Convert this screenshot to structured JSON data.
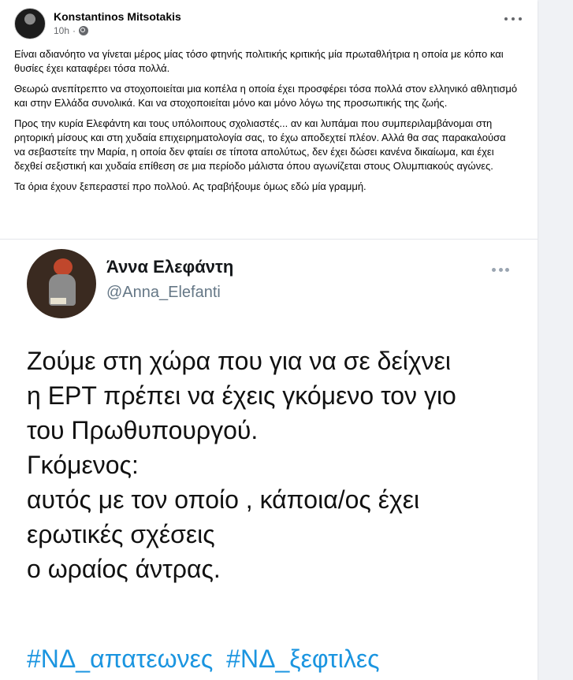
{
  "post": {
    "author": "Konstantinos Mitsotakis",
    "time": "10h",
    "separator": "·",
    "audience_icon": "globe-icon",
    "more_icon": "more-options-icon",
    "paragraphs": [
      "Είναι αδιανόητο να γίνεται μέρος μίας τόσο φτηνής πολιτικής κριτικής μία πρωταθλήτρια η οποία με κόπο και θυσίες έχει καταφέρει τόσα πολλά.",
      "Θεωρώ ανεπίτρεπτο να στοχοποιείται μια κοπέλα η οποία έχει προσφέρει τόσα πολλά στον ελληνικό αθλητισμό και στην Ελλάδα συνολικά. Και να στοχοποιείται μόνο και μόνο λόγω της προσωπικής της ζωής.",
      "Προς την κυρία Ελεφάντη και τους υπόλοιπους σχολιαστές... αν και λυπάμαι που συμπεριλαμβάνομαι στη ρητορική μίσους και στη χυδαία επιχειρηματολογία σας, το έχω αποδεχτεί πλέον. Αλλά θα σας παρακαλούσα να σεβαστείτε την Μαρία, η οποία δεν φταίει σε τίποτα απολύτως, δεν έχει δώσει κανένα δικαίωμα, και έχει δεχθεί σεξιστική και χυδαία επίθεση σε μια περίοδο μάλιστα όπου αγωνίζεται στους Ολυμπιακούς αγώνες.",
      "Τα όρια έχουν ξεπεραστεί προ πολλού. Ας τραβήξουμε όμως εδώ μία γραμμή."
    ]
  },
  "tweet": {
    "name": "Άννα Ελεφάντη",
    "handle": "@Anna_Elefanti",
    "lines": [
      "Ζούμε στη χώρα που για να σε δείχνει",
      "η ΕΡΤ πρέπει να έχεις γκόμενο τον γιο",
      "του Πρωθυπουργού.",
      "Γκόμενος:",
      "αυτός με τον οποίο , κάποια/ος έχει",
      "ερωτικές σχέσεις",
      "ο ωραίος άντρας."
    ],
    "hashtags": [
      "#ΝΔ_απατεωνες",
      "#ΝΔ_ξεφτιλες"
    ]
  },
  "colors": {
    "page_bg": "#f0f2f5",
    "card_bg": "#ffffff",
    "text_primary": "#050505",
    "text_secondary": "#65676b",
    "hashtag": "#1b95e0",
    "tweet_handle": "#657786"
  }
}
